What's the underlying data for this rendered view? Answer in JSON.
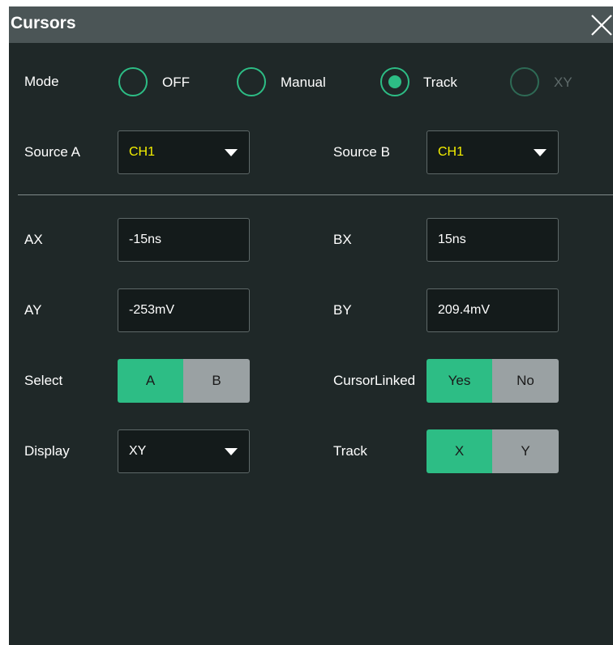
{
  "title": "Cursors",
  "colors": {
    "accent": "#2dbd85",
    "panel_bg": "#1f2828",
    "title_bg": "#4b5556",
    "source_text": "#f5f000",
    "segment_off": "#9aa1a3"
  },
  "mode": {
    "label": "Mode",
    "options": [
      {
        "label": "OFF",
        "selected": false,
        "enabled": true
      },
      {
        "label": "Manual",
        "selected": false,
        "enabled": true
      },
      {
        "label": "Track",
        "selected": true,
        "enabled": true
      },
      {
        "label": "XY",
        "selected": false,
        "enabled": false
      }
    ]
  },
  "source_a": {
    "label": "Source A",
    "value": "CH1"
  },
  "source_b": {
    "label": "Source B",
    "value": "CH1"
  },
  "ax": {
    "label": "AX",
    "value": "-15ns"
  },
  "bx": {
    "label": "BX",
    "value": "15ns"
  },
  "ay": {
    "label": "AY",
    "value": "-253mV"
  },
  "by": {
    "label": "BY",
    "value": "209.4mV"
  },
  "select": {
    "label": "Select",
    "options": [
      "A",
      "B"
    ],
    "selected": "A"
  },
  "cursor_linked": {
    "label": "CursorLinked",
    "options": [
      "Yes",
      "No"
    ],
    "selected": "Yes"
  },
  "display": {
    "label": "Display",
    "value": "XY"
  },
  "track": {
    "label": "Track",
    "options": [
      "X",
      "Y"
    ],
    "selected": "X"
  },
  "icons": {
    "close": "close-icon",
    "dropdown": "caret-down-icon"
  }
}
